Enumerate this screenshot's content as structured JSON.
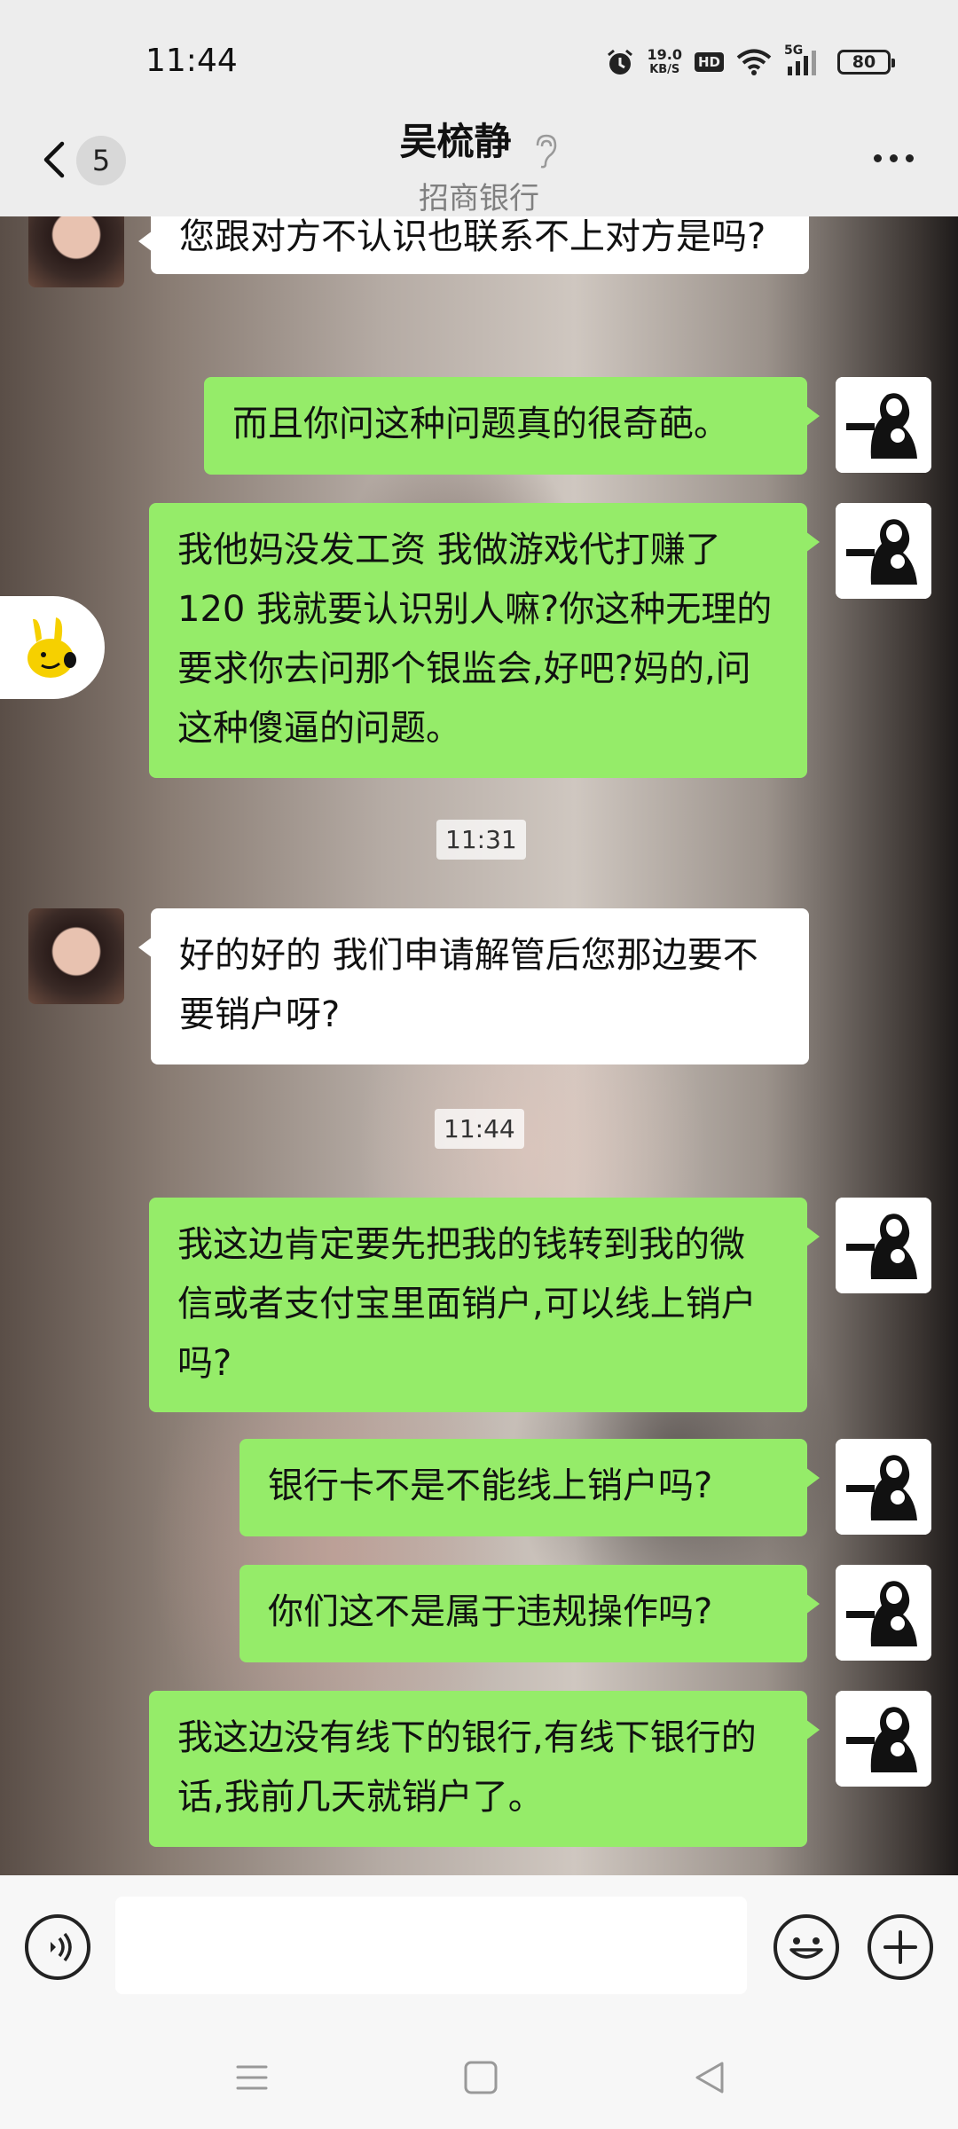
{
  "status_bar": {
    "time": "11:44",
    "net_speed_value": "19.0",
    "net_speed_unit": "KB/S",
    "hd": "HD",
    "signal_label": "5G",
    "battery": "80",
    "icons": [
      "alarm-icon",
      "wifi-icon",
      "signal-icon",
      "battery-icon"
    ]
  },
  "header": {
    "unread_count": "5",
    "title": "吴梳静",
    "subtitle": "招商银行",
    "icons": [
      "back-icon",
      "ear-icon",
      "more-icon"
    ]
  },
  "messages": [
    {
      "from": "them",
      "text": "您跟对方不认识也联系不上对方是吗?"
    },
    {
      "from": "me",
      "text": "而且你问这种问题真的很奇葩。"
    },
    {
      "from": "me",
      "text": "我他妈没发工资 我做游戏代打赚了120 我就要认识别人嘛?你这种无理的要求你去问那个银监会,好吧?妈的,问这种傻逼的问题。"
    },
    {
      "type": "time",
      "text": "11:31"
    },
    {
      "from": "them",
      "text": "好的好的 我们申请解管后您那边要不要销户呀?"
    },
    {
      "type": "time",
      "text": "11:44"
    },
    {
      "from": "me",
      "text": "我这边肯定要先把我的钱转到我的微信或者支付宝里面销户,可以线上销户吗?"
    },
    {
      "from": "me",
      "text": "银行卡不是不能线上销户吗?"
    },
    {
      "from": "me",
      "text": "你们这不是属于违规操作吗?"
    },
    {
      "from": "me",
      "text": "我这边没有线下的银行,有线下银行的话,我前几天就销户了。"
    }
  ],
  "input_bar": {
    "placeholder": "",
    "icons": [
      "voice-icon",
      "emoji-icon",
      "plus-icon"
    ]
  },
  "nav_bar": {
    "icons": [
      "menu-icon",
      "home-icon",
      "back-triangle-icon"
    ]
  },
  "colors": {
    "my_bubble": "#95ec69",
    "their_bubble": "#ffffff",
    "header_bg": "#ededed"
  }
}
